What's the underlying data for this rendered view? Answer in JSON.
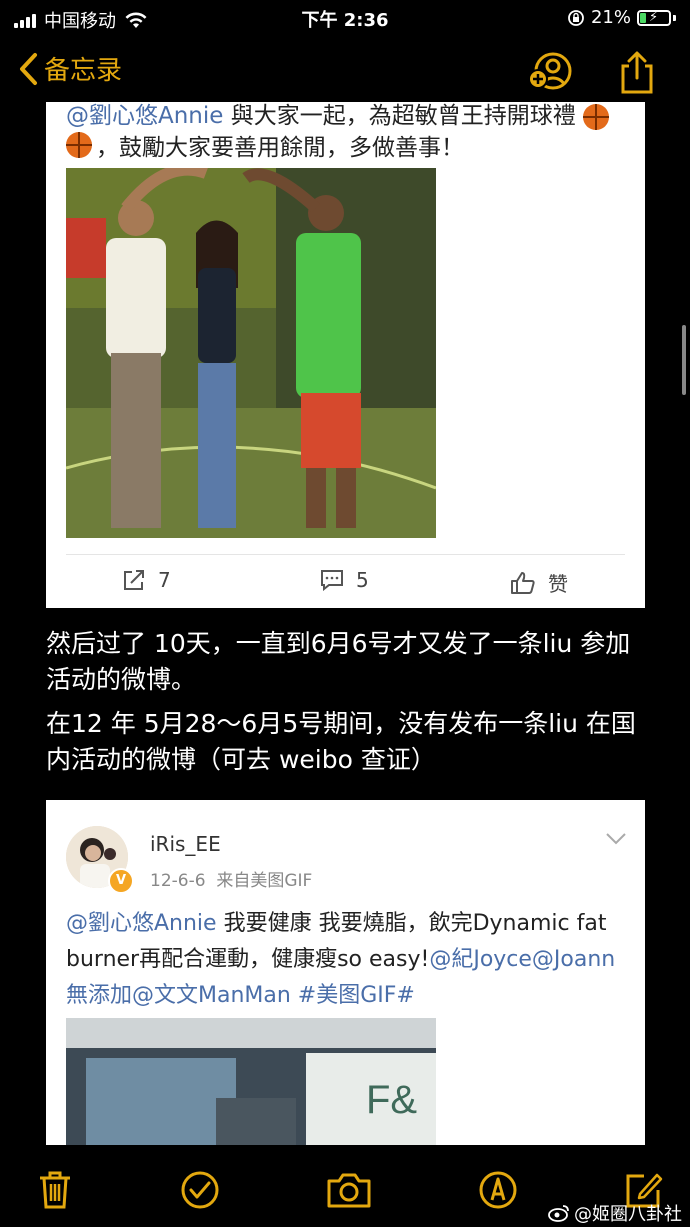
{
  "status_bar": {
    "carrier": "中国移动",
    "time": "下午 2:36",
    "battery_percent": "21%",
    "battery_level": 0.21
  },
  "nav": {
    "back_label": "备忘录",
    "accent_color": "#e3a80f"
  },
  "card1": {
    "cut_text_mention": "@劉心悠Annie",
    "cut_text_rest": " 與大家一起，為超敏曾王持開球禮",
    "line2": "，鼓勵大家要善用餘閒，多做善事！",
    "repost_count": "7",
    "comment_count": "5",
    "like_label": "赞"
  },
  "paragraphs": [
    "然后过了 10天，一直到6月6号才又发了一条liu 参加活动的微博。",
    "在12 年 5月28～6月5号期间，没有发布一条liu 在国内活动的微博（可去 weibo 查证）"
  ],
  "card2": {
    "username": "iRis_EE",
    "date": "12-6-6",
    "source": "来自美图GIF",
    "post_mention": "@劉心悠Annie",
    "post_text_1": " 我要健康 我要燒脂，飲完Dynamic fat burner再配合運動，健康瘦so easy!",
    "post_links": "@紀Joyce@Joann無添加@文文ManMan #美图GIF#"
  },
  "watermark": "@姬圈八卦社",
  "icons": {
    "back": "chevron-left-icon",
    "add_people": "add-person-icon",
    "share": "share-icon",
    "trash": "trash-icon",
    "check": "checkmark-icon",
    "camera": "camera-icon",
    "markup": "pen-icon",
    "compose": "compose-icon"
  }
}
